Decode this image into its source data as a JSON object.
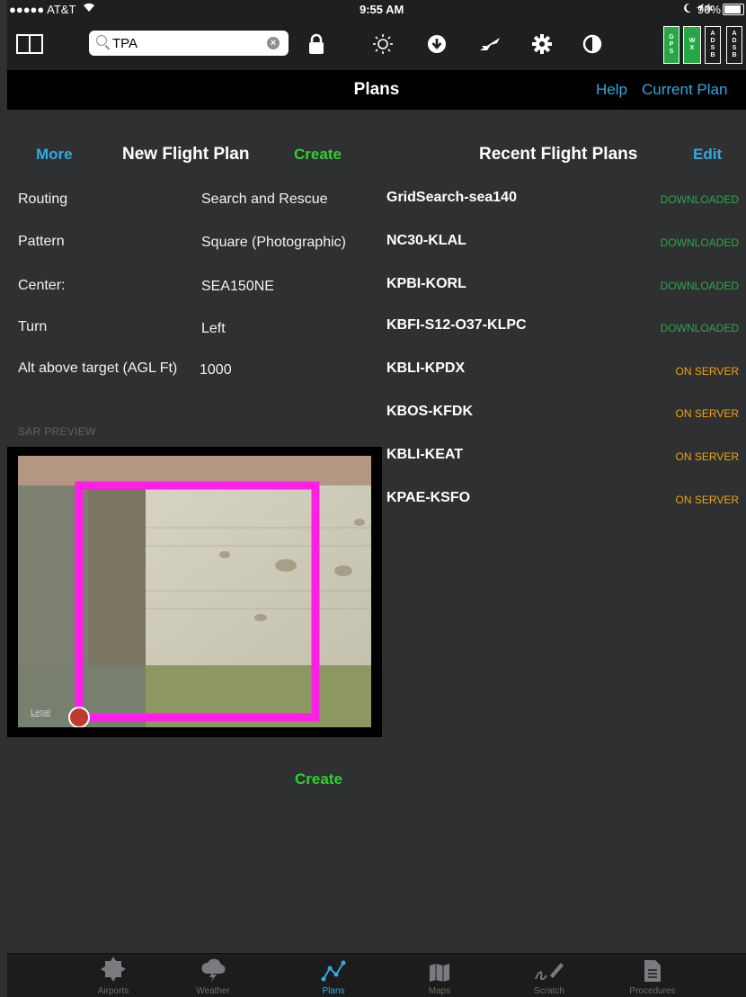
{
  "status": {
    "carrier": "●●●●● AT&T",
    "time": "9:55 AM",
    "battery": "90%"
  },
  "toolbar": {
    "search_value": "TPA",
    "badges": {
      "gps": [
        "G",
        "P",
        "S"
      ],
      "wx": [
        "W",
        "X"
      ],
      "adsb1": [
        "A",
        "D",
        "S",
        "B"
      ],
      "adsb2": [
        "A",
        "D",
        "S",
        "B"
      ]
    }
  },
  "nav": {
    "title": "Plans",
    "help": "Help",
    "current_plan": "Current Plan"
  },
  "new_plan": {
    "more": "More",
    "header": "New Flight Plan",
    "create_top": "Create",
    "fields": [
      {
        "label": "Routing",
        "value": "Search and Rescue"
      },
      {
        "label": "Pattern",
        "value": "Square (Photographic)"
      },
      {
        "label": "Center:",
        "value": "SEA150NE"
      },
      {
        "label": "Turn",
        "value": "Left"
      },
      {
        "label": "Alt above target (AGL Ft)",
        "value": "1000"
      }
    ],
    "preview_label": "SAR PREVIEW",
    "legal": "Legal",
    "create_bottom": "Create"
  },
  "recent": {
    "header": "Recent Flight Plans",
    "edit": "Edit",
    "plans": [
      {
        "name": "GridSearch-sea140",
        "status": "DOWNLOADED"
      },
      {
        "name": "NC30-KLAL",
        "status": "DOWNLOADED"
      },
      {
        "name": "KPBI-KORL",
        "status": "DOWNLOADED"
      },
      {
        "name": "KBFI-S12-O37-KLPC",
        "status": "DOWNLOADED"
      },
      {
        "name": "KBLI-KPDX",
        "status": "ON SERVER"
      },
      {
        "name": "KBOS-KFDK",
        "status": "ON SERVER"
      },
      {
        "name": "KBLI-KEAT",
        "status": "ON SERVER"
      },
      {
        "name": "KPAE-KSFO",
        "status": "ON SERVER"
      }
    ]
  },
  "tabs": [
    "Airports",
    "Weather",
    "Plans",
    "Maps",
    "Scratch",
    "Procedures"
  ],
  "colors": {
    "accent_blue": "#31a9e2",
    "create_green": "#2cd22c",
    "downloaded": "#2aa844",
    "on_server": "#f0a20a",
    "route_magenta": "#ff1ee6"
  }
}
